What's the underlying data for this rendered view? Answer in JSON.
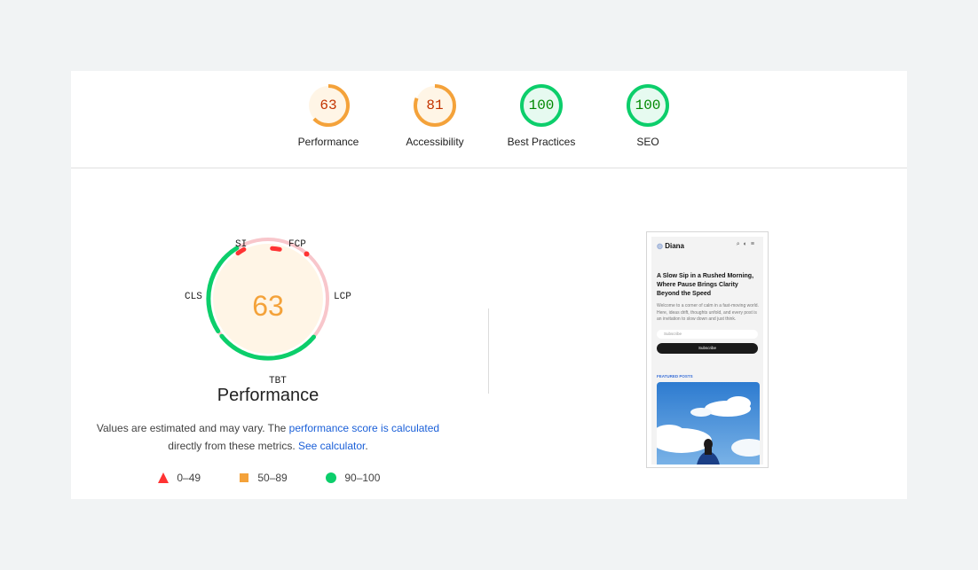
{
  "categories": [
    {
      "score": "63",
      "label": "Performance",
      "fraction": 0.63,
      "color": "#f4a23a",
      "text_color": "#c33300",
      "bg": "#fff5e6"
    },
    {
      "score": "81",
      "label": "Accessibility",
      "fraction": 0.81,
      "color": "#f4a23a",
      "text_color": "#c33300",
      "bg": "#fff5e6"
    },
    {
      "score": "100",
      "label": "Best Practices",
      "fraction": 1.0,
      "color": "#0cce6b",
      "text_color": "#008800",
      "bg": "#e6faf0"
    },
    {
      "score": "100",
      "label": "SEO",
      "fraction": 1.0,
      "color": "#0cce6b",
      "text_color": "#008800",
      "bg": "#e6faf0"
    }
  ],
  "performance": {
    "score": "63",
    "title": "Performance",
    "metrics": {
      "si": "SI",
      "fcp": "FCP",
      "lcp": "LCP",
      "tbt": "TBT",
      "cls": "CLS"
    },
    "description": {
      "part1": "Values are estimated and may vary. The ",
      "link1": "performance score is calculated",
      "part2": " directly from these metrics. ",
      "link2": "See calculator",
      "part3": "."
    },
    "legend": {
      "fail": "0–49",
      "average": "50–89",
      "pass": "90–100"
    },
    "colors": {
      "fail": "#ff3333",
      "average": "#ffa400",
      "pass": "#0cce6b"
    }
  },
  "screenshot": {
    "site_name": "Diana",
    "headline": "A Slow Sip in a Rushed Morning, Where Pause Brings Clarity Beyond the Speed",
    "body": "Welcome to a corner of calm in a fast-moving world. Here, ideas drift, thoughts unfold, and every post is an invitation to slow down and just think.",
    "input_placeholder": "Subscribe",
    "button_label": "Subscribe",
    "featured_label": "FEATURED POSTS"
  }
}
